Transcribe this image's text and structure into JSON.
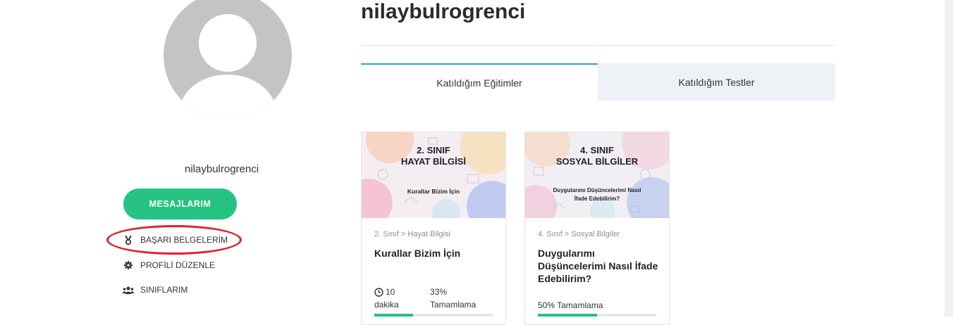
{
  "profile": {
    "username": "nilaybulrogrenci",
    "messages_button": "MESAJLARIM",
    "menu": [
      {
        "label": "BAŞARI BELGELERİM",
        "icon": "medal-icon"
      },
      {
        "label": "PROFİLİ DÜZENLE",
        "icon": "gear-icon"
      },
      {
        "label": "SINIFLARIM",
        "icon": "users-icon"
      }
    ]
  },
  "header": {
    "title": "nilaybulrogrenci"
  },
  "tabs": [
    {
      "label": "Katıldığım Eğitimler",
      "active": true
    },
    {
      "label": "Katıldığım Testler",
      "active": false
    }
  ],
  "courses": [
    {
      "thumb_title_line1": "2. SINIF",
      "thumb_title_line2": "HAYAT BİLGİSİ",
      "thumb_subtitle": "Kurallar Bizim İçin",
      "breadcrumb": "2. Sınıf > Hayat Bilgisi",
      "title": "Kurallar Bizim İçin",
      "duration_line1": "10",
      "duration_line2": "dakika",
      "progress_line1": "33%",
      "progress_line2": "Tamamlama",
      "progress": 33
    },
    {
      "thumb_title_line1": "4. SINIF",
      "thumb_title_line2": "SOSYAL BİLGİLER",
      "thumb_subtitle_line1": "Duygularımı Düşüncelerimi Nasıl",
      "thumb_subtitle_line2": "İfade Edebilirim?",
      "breadcrumb": "4. Sınıf > Sosyal Bilgiler",
      "title": "Duygularımı Düşüncelerimi Nasıl İfade Edebilirim?",
      "progress_text": "50% Tamamlama",
      "progress": 50
    }
  ],
  "colors": {
    "accent_green": "#26c281",
    "tab_active_border": "#2a9fd8",
    "highlight_oval": "#e0202a"
  }
}
